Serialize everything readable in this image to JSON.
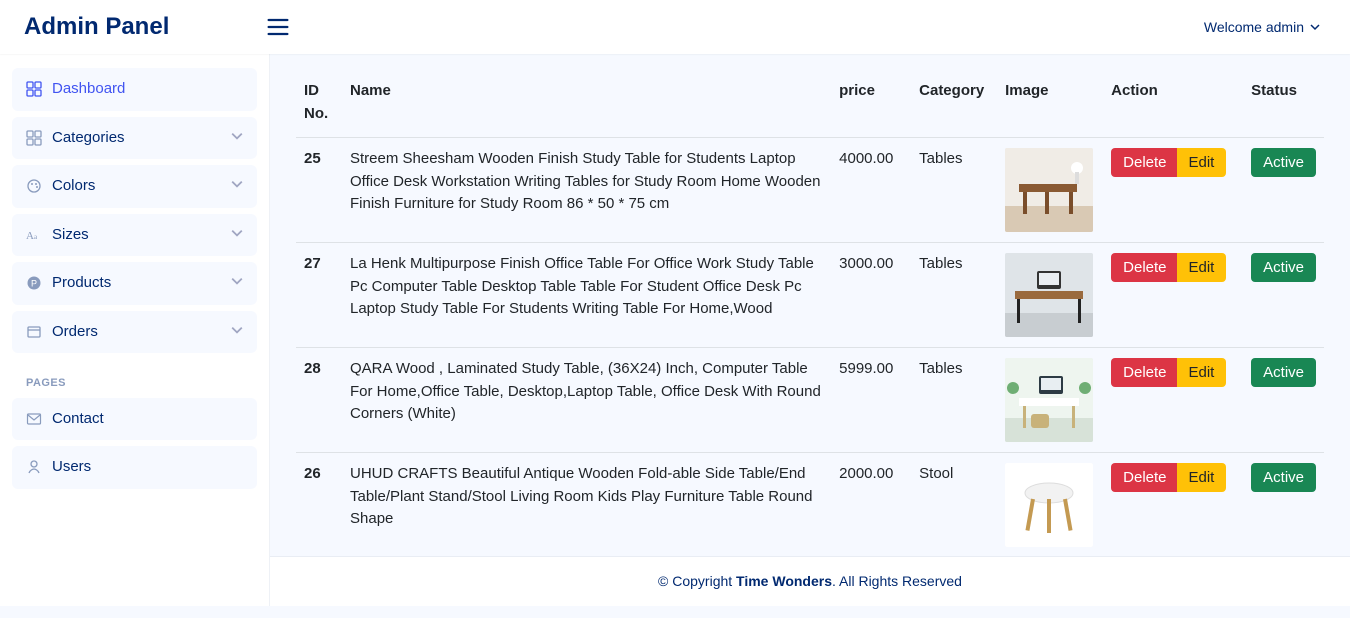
{
  "app_title": "Admin Panel",
  "user_greeting": "Welcome admin",
  "sidebar": {
    "items": [
      {
        "label": "Dashboard",
        "icon": "grid",
        "has_children": false,
        "active": true
      },
      {
        "label": "Categories",
        "icon": "grid",
        "has_children": true,
        "active": false
      },
      {
        "label": "Colors",
        "icon": "palette",
        "has_children": true,
        "active": false
      },
      {
        "label": "Sizes",
        "icon": "type",
        "has_children": true,
        "active": false
      },
      {
        "label": "Products",
        "icon": "circle-p",
        "has_children": true,
        "active": false
      },
      {
        "label": "Orders",
        "icon": "box",
        "has_children": true,
        "active": false
      }
    ],
    "pages_heading": "PAGES",
    "pages": [
      {
        "label": "Contact",
        "icon": "envelope"
      },
      {
        "label": "Users",
        "icon": "person"
      }
    ]
  },
  "table": {
    "columns": {
      "id": "ID No.",
      "name": "Name",
      "price": "price",
      "category": "Category",
      "image": "Image",
      "action": "Action",
      "status": "Status"
    },
    "buttons": {
      "delete": "Delete",
      "edit": "Edit",
      "active": "Active"
    },
    "rows": [
      {
        "id": "25",
        "name": "Streem Sheesham Wooden Finish Study Table for Students Laptop Office Desk Workstation Writing Tables for Study Room Home Wooden Finish Furniture for Study Room 86 * 50 * 75 cm",
        "price": "4000.00",
        "category": "Tables",
        "image_variant": "wood-desk-light-room"
      },
      {
        "id": "27",
        "name": "La Henk Multipurpose Finish Office Table For Office Work Study Table Pc Computer Table Desktop Table Table For Student Office Desk Pc Laptop Study Table For Students Writing Table For Home,Wood",
        "price": "3000.00",
        "category": "Tables",
        "image_variant": "wood-desk-black-legs"
      },
      {
        "id": "28",
        "name": "QARA Wood , Laminated Study Table, (36X24) Inch, Computer Table For Home,Office Table, Desktop,Laptop Table, Office Desk With Round Corners (White)",
        "price": "5999.00",
        "category": "Tables",
        "image_variant": "white-desk-plants"
      },
      {
        "id": "26",
        "name": "UHUD CRAFTS Beautiful Antique Wooden Fold-able Side Table/End Table/Plant Stand/Stool Living Room Kids Play Furniture Table Round Shape",
        "price": "2000.00",
        "category": "Stool",
        "image_variant": "round-white-stool"
      }
    ]
  },
  "footer": {
    "prefix": "© Copyright ",
    "brand": "Time Wonders",
    "suffix": ". All Rights Reserved"
  }
}
